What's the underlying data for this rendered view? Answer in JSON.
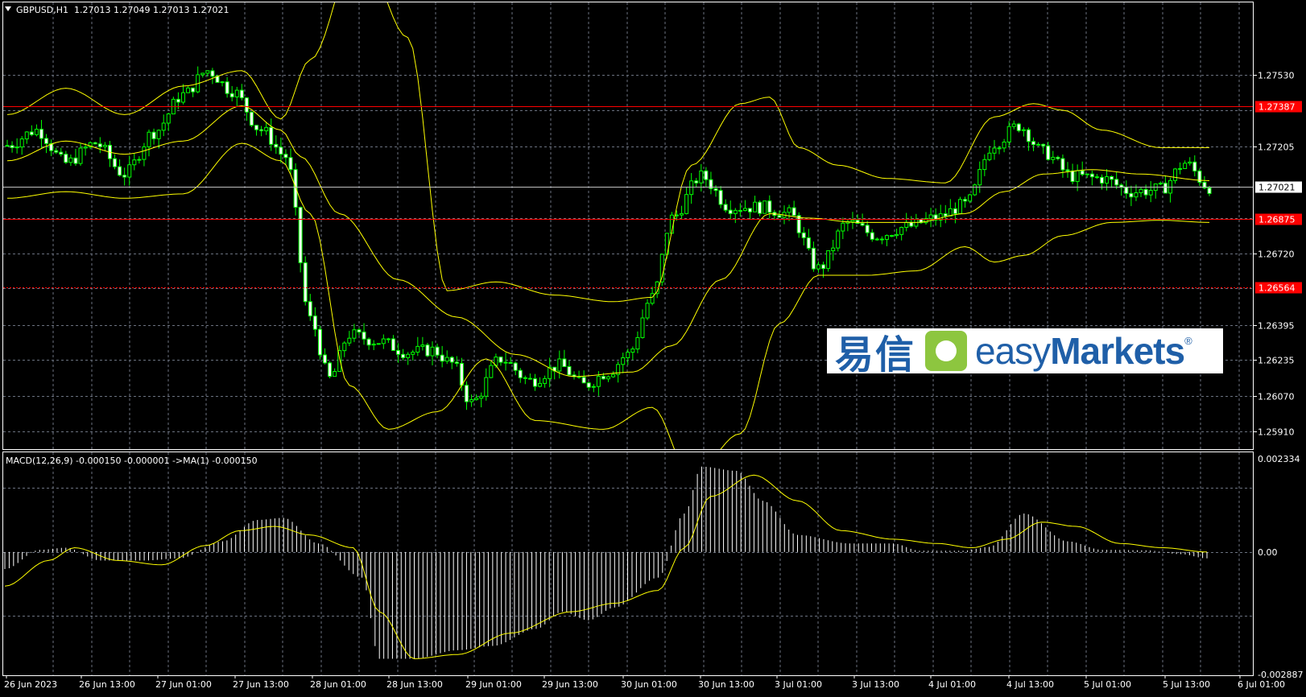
{
  "header": {
    "symbol_timeframe": "GBPUSD,H1",
    "ohlc": "1.27013 1.27049 1.27013 1.27021",
    "dropdown_icon": "triangle-down-icon"
  },
  "macd": {
    "label": "MACD(12,26,9) -0.000150 -0.000001  ->MA(1) -0.000150",
    "axis_labels": [
      "0.002334",
      "0.00",
      "-0.002887"
    ]
  },
  "logo": {
    "chinese": "易信",
    "brand_light": "easy",
    "brand_bold": "Markets",
    "reg": "®"
  },
  "colors": {
    "background": "#000000",
    "grid": "#6b7280",
    "bull": "#00ff00",
    "bear": "#ffffff",
    "bands": "#ffff00",
    "hline": "#ff0000",
    "macd_signal": "#ffff00",
    "macd_hist": "#ffffff"
  },
  "chart_data": [
    {
      "type": "candlestick",
      "symbol": "GBPUSD",
      "timeframe": "H1",
      "indicator": "bollinger-bands",
      "ylim": [
        1.2583,
        1.2786
      ],
      "y_tick_labels": [
        "1.27530",
        "1.27205",
        "1.26720",
        "1.26395",
        "1.26235",
        "1.26070",
        "1.25910"
      ],
      "y_ticks": [
        1.2753,
        1.27205,
        1.2672,
        1.26395,
        1.26235,
        1.2607,
        1.2591
      ],
      "x_tick_labels": [
        "26 Jun 2023",
        "26 Jun 13:00",
        "27 Jun 01:00",
        "27 Jun 13:00",
        "28 Jun 01:00",
        "28 Jun 13:00",
        "29 Jun 01:00",
        "29 Jun 13:00",
        "30 Jun 01:00",
        "30 Jun 13:00",
        "3 Jul 01:00",
        "3 Jul 13:00",
        "4 Jul 01:00",
        "4 Jul 13:00",
        "5 Jul 01:00",
        "5 Jul 13:00",
        "6 Jul 01:00"
      ],
      "horizontal_lines": [
        {
          "price": 1.27387,
          "label": "1.27387",
          "style": "solid"
        },
        {
          "price": 1.26875,
          "label": "1.26875",
          "style": "solid"
        },
        {
          "price": 1.26564,
          "label": "1.26564",
          "style": "dashed"
        }
      ],
      "current_price": {
        "price": 1.27021,
        "label": "1.27021"
      },
      "close_anchors": [
        [
          0,
          1.2721
        ],
        [
          6,
          1.2728
        ],
        [
          12,
          1.2713
        ],
        [
          18,
          1.2722
        ],
        [
          24,
          1.2708
        ],
        [
          30,
          1.2727
        ],
        [
          36,
          1.2744
        ],
        [
          41,
          1.2755
        ],
        [
          46,
          1.2746
        ],
        [
          52,
          1.2728
        ],
        [
          57,
          1.2716
        ],
        [
          62,
          1.2642
        ],
        [
          66,
          1.2615
        ],
        [
          70,
          1.2635
        ],
        [
          76,
          1.2632
        ],
        [
          82,
          1.2627
        ],
        [
          87,
          1.2628
        ],
        [
          91,
          1.2622
        ],
        [
          95,
          1.2604
        ],
        [
          101,
          1.2624
        ],
        [
          107,
          1.2614
        ],
        [
          113,
          1.2621
        ],
        [
          118,
          1.2612
        ],
        [
          123,
          1.2618
        ],
        [
          127,
          1.2626
        ],
        [
          132,
          1.2652
        ],
        [
          136,
          1.2688
        ],
        [
          142,
          1.2707
        ],
        [
          148,
          1.2693
        ],
        [
          154,
          1.2693
        ],
        [
          160,
          1.269
        ],
        [
          166,
          1.2665
        ],
        [
          172,
          1.2686
        ],
        [
          178,
          1.268
        ],
        [
          184,
          1.2684
        ],
        [
          190,
          1.2688
        ],
        [
          196,
          1.2694
        ],
        [
          202,
          1.2722
        ],
        [
          207,
          1.273
        ],
        [
          212,
          1.2718
        ],
        [
          218,
          1.2707
        ],
        [
          224,
          1.2706
        ],
        [
          230,
          1.27
        ],
        [
          236,
          1.2701
        ],
        [
          241,
          1.2713
        ],
        [
          246,
          1.2702
        ]
      ],
      "n_bars": 247,
      "bands_upper_anchors": [
        [
          0,
          1.2735
        ],
        [
          12,
          1.2747
        ],
        [
          24,
          1.2735
        ],
        [
          36,
          1.2748
        ],
        [
          48,
          1.2755
        ],
        [
          56,
          1.2733
        ],
        [
          62,
          1.276
        ],
        [
          72,
          1.2812
        ],
        [
          82,
          1.277
        ],
        [
          90,
          1.2655
        ],
        [
          100,
          1.2659
        ],
        [
          112,
          1.2653
        ],
        [
          124,
          1.265
        ],
        [
          132,
          1.2652
        ],
        [
          140,
          1.2712
        ],
        [
          150,
          1.274
        ],
        [
          156,
          1.2743
        ],
        [
          162,
          1.272
        ],
        [
          170,
          1.2712
        ],
        [
          180,
          1.2706
        ],
        [
          192,
          1.2704
        ],
        [
          202,
          1.2734
        ],
        [
          210,
          1.274
        ],
        [
          216,
          1.2737
        ],
        [
          224,
          1.2728
        ],
        [
          236,
          1.272
        ],
        [
          246,
          1.272
        ]
      ],
      "bands_lower_anchors": [
        [
          0,
          1.2697
        ],
        [
          12,
          1.27
        ],
        [
          24,
          1.2697
        ],
        [
          36,
          1.2699
        ],
        [
          48,
          1.2722
        ],
        [
          56,
          1.2714
        ],
        [
          62,
          1.269
        ],
        [
          70,
          1.2612
        ],
        [
          78,
          1.2592
        ],
        [
          88,
          1.26
        ],
        [
          98,
          1.2624
        ],
        [
          108,
          1.2596
        ],
        [
          122,
          1.2592
        ],
        [
          132,
          1.2602
        ],
        [
          140,
          1.257
        ],
        [
          150,
          1.259
        ],
        [
          158,
          1.264
        ],
        [
          166,
          1.2662
        ],
        [
          176,
          1.2662
        ],
        [
          186,
          1.2664
        ],
        [
          196,
          1.2675
        ],
        [
          202,
          1.2668
        ],
        [
          208,
          1.2671
        ],
        [
          216,
          1.268
        ],
        [
          226,
          1.2686
        ],
        [
          236,
          1.2687
        ],
        [
          246,
          1.2686
        ]
      ],
      "bands_middle_anchors": [
        [
          0,
          1.2714
        ],
        [
          12,
          1.2723
        ],
        [
          24,
          1.2717
        ],
        [
          36,
          1.2723
        ],
        [
          48,
          1.2739
        ],
        [
          56,
          1.2728
        ],
        [
          60,
          1.2716
        ],
        [
          68,
          1.269
        ],
        [
          80,
          1.266
        ],
        [
          92,
          1.2643
        ],
        [
          104,
          1.2626
        ],
        [
          116,
          1.2616
        ],
        [
          128,
          1.2618
        ],
        [
          136,
          1.263
        ],
        [
          146,
          1.266
        ],
        [
          156,
          1.269
        ],
        [
          164,
          1.2688
        ],
        [
          174,
          1.2686
        ],
        [
          186,
          1.2686
        ],
        [
          196,
          1.269
        ],
        [
          204,
          1.27
        ],
        [
          212,
          1.2708
        ],
        [
          222,
          1.271
        ],
        [
          232,
          1.2708
        ],
        [
          246,
          1.2705
        ]
      ]
    },
    {
      "type": "macd",
      "parameters": "MACD(12,26,9)",
      "ylim": [
        -0.002887,
        0.002334
      ],
      "y_tick_labels": [
        "0.002334",
        "0.00",
        "-0.002887"
      ],
      "hist_anchors": [
        [
          0,
          -0.0004
        ],
        [
          8,
          5e-05
        ],
        [
          14,
          0.0001
        ],
        [
          22,
          -0.0002
        ],
        [
          32,
          -0.0002
        ],
        [
          40,
          -0.00015
        ],
        [
          50,
          0.00025
        ],
        [
          58,
          0.00075
        ],
        [
          64,
          0.0008
        ],
        [
          72,
          0.0002
        ],
        [
          82,
          -0.0006
        ],
        [
          86,
          -0.0025
        ],
        [
          94,
          -0.0025
        ],
        [
          104,
          -0.0023
        ],
        [
          112,
          -0.0022
        ],
        [
          122,
          -0.0018
        ],
        [
          128,
          -0.0014
        ],
        [
          134,
          -0.0016
        ],
        [
          140,
          -0.0013
        ],
        [
          150,
          -0.0006
        ],
        [
          156,
          0.0009
        ],
        [
          160,
          0.002
        ],
        [
          168,
          0.0019
        ],
        [
          174,
          0.0012
        ],
        [
          182,
          0.0004
        ],
        [
          194,
          0.0002
        ],
        [
          204,
          0.0002
        ],
        [
          210,
          3e-05
        ],
        [
          220,
          3e-05
        ],
        [
          226,
          0.00012
        ],
        [
          234,
          0.0009
        ],
        [
          244,
          0.00025
        ],
        [
          252,
          5e-05
        ],
        [
          262,
          4e-05
        ],
        [
          270,
          -5e-05
        ],
        [
          276,
          -0.00015
        ]
      ],
      "signal_anchors": [
        [
          0,
          -0.0008
        ],
        [
          10,
          -0.0002
        ],
        [
          16,
          0.0001
        ],
        [
          26,
          -0.0002
        ],
        [
          36,
          -0.0003
        ],
        [
          46,
          0.00015
        ],
        [
          54,
          0.0005
        ],
        [
          62,
          0.0006
        ],
        [
          70,
          0.0004
        ],
        [
          80,
          0.0001
        ],
        [
          86,
          -0.0014
        ],
        [
          94,
          -0.0025
        ],
        [
          104,
          -0.0024
        ],
        [
          116,
          -0.0019
        ],
        [
          130,
          -0.0014
        ],
        [
          140,
          -0.0012
        ],
        [
          150,
          -0.0009
        ],
        [
          156,
          0.0001
        ],
        [
          162,
          0.0013
        ],
        [
          172,
          0.0018
        ],
        [
          182,
          0.0012
        ],
        [
          192,
          0.0005
        ],
        [
          204,
          0.0003
        ],
        [
          214,
          0.0002
        ],
        [
          222,
          0.0001
        ],
        [
          230,
          0.0003
        ],
        [
          238,
          0.0007
        ],
        [
          246,
          0.0006
        ],
        [
          256,
          0.0002
        ],
        [
          266,
          0.0001
        ],
        [
          276,
          0.0
        ]
      ],
      "n_bars": 277
    }
  ]
}
